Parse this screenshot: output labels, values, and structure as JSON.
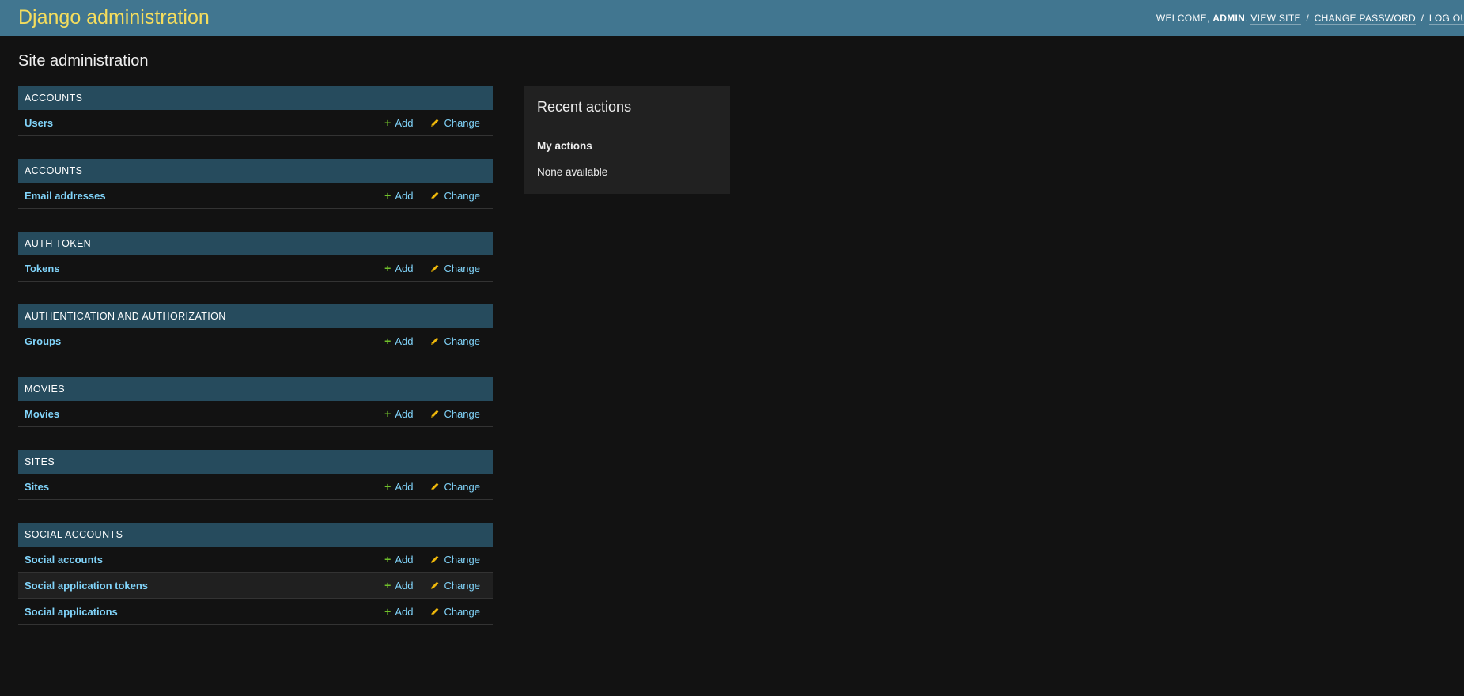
{
  "header": {
    "branding": "Django administration",
    "welcome": "Welcome,",
    "username": "admin",
    "view_site": "View site",
    "change_password": "Change password",
    "log_out": "Log out"
  },
  "page": {
    "title": "Site administration"
  },
  "modules": [
    {
      "caption": "Accounts",
      "models": [
        {
          "name": "Users",
          "add": "Add",
          "change": "Change"
        }
      ]
    },
    {
      "caption": "Accounts",
      "models": [
        {
          "name": "Email addresses",
          "add": "Add",
          "change": "Change"
        }
      ]
    },
    {
      "caption": "Auth Token",
      "models": [
        {
          "name": "Tokens",
          "add": "Add",
          "change": "Change"
        }
      ]
    },
    {
      "caption": "Authentication and Authorization",
      "models": [
        {
          "name": "Groups",
          "add": "Add",
          "change": "Change"
        }
      ]
    },
    {
      "caption": "Movies",
      "models": [
        {
          "name": "Movies",
          "add": "Add",
          "change": "Change"
        }
      ]
    },
    {
      "caption": "Sites",
      "models": [
        {
          "name": "Sites",
          "add": "Add",
          "change": "Change"
        }
      ]
    },
    {
      "caption": "Social Accounts",
      "models": [
        {
          "name": "Social accounts",
          "add": "Add",
          "change": "Change"
        },
        {
          "name": "Social application tokens",
          "add": "Add",
          "change": "Change"
        },
        {
          "name": "Social applications",
          "add": "Add",
          "change": "Change"
        }
      ]
    }
  ],
  "recent_actions": {
    "title": "Recent actions",
    "my_actions": "My actions",
    "empty": "None available"
  },
  "icons": {
    "add": "plus-icon",
    "change": "pencil-icon"
  },
  "colors": {
    "header_bg": "#417690",
    "branding": "#f5dd5d",
    "module_caption_bg": "#264b5d",
    "link": "#81d4fa",
    "add_icon": "#70bf2b",
    "change_icon": "#efb80b",
    "page_bg": "#121212"
  }
}
